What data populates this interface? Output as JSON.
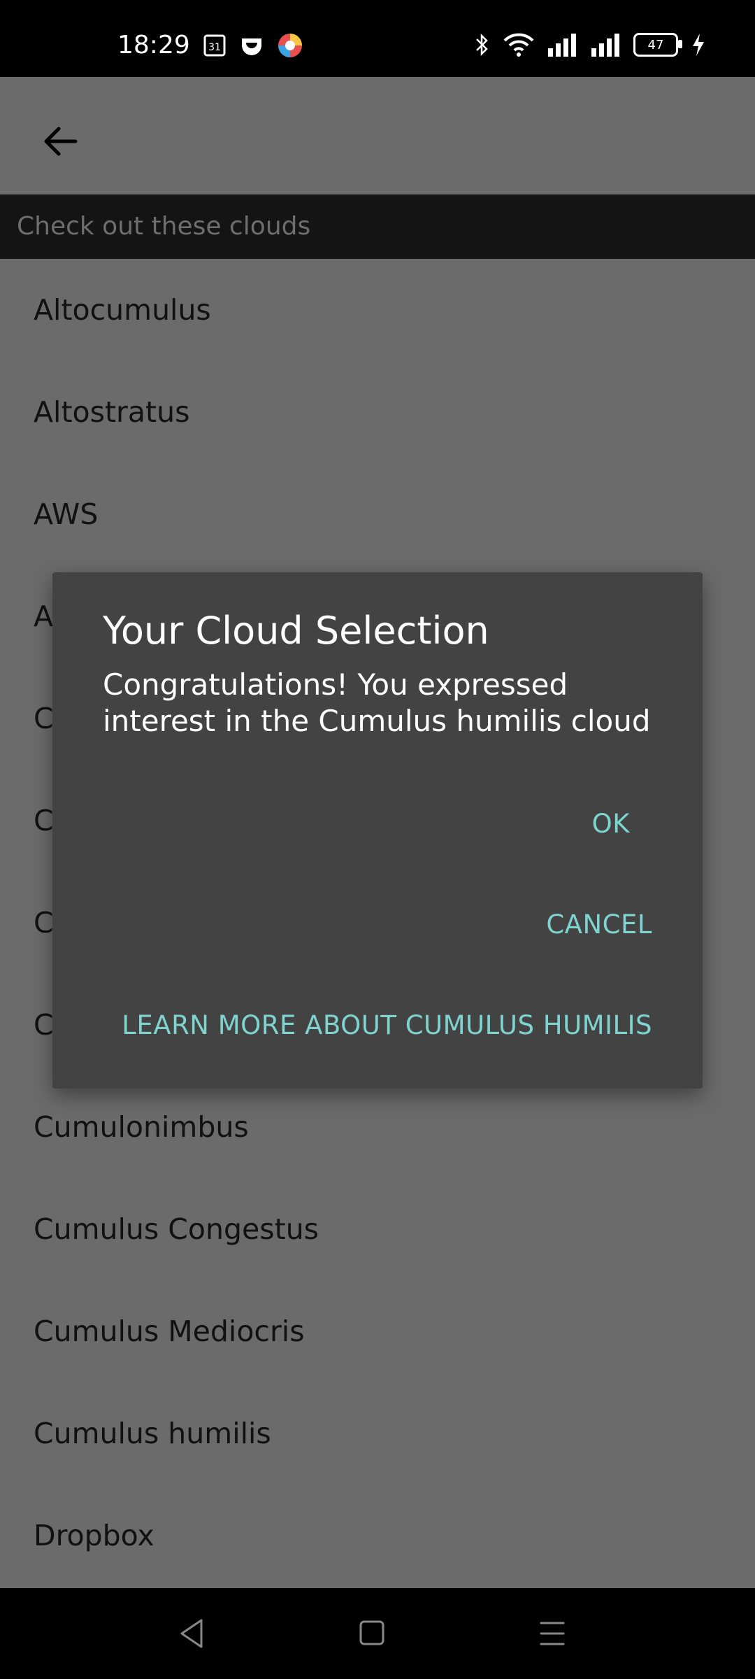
{
  "status_bar": {
    "time": "18:29",
    "calendar_day": "31",
    "battery": "47"
  },
  "header": {
    "back_icon": "arrow-left-icon"
  },
  "section_header": "Check out these clouds",
  "list_items": [
    "Altocumulus",
    "Altostratus",
    "AWS",
    "A",
    "C",
    "C",
    "C",
    "C",
    "Cumulonimbus",
    "Cumulus Congestus",
    "Cumulus Mediocris",
    "Cumulus humilis",
    "Dropbox"
  ],
  "dialog": {
    "title": "Your Cloud Selection",
    "message": "Congratulations! You expressed interest in the Cumulus humilis cloud",
    "ok": "OK",
    "cancel": "CANCEL",
    "learn_more": "LEARN MORE ABOUT CUMULUS HUMILIS"
  },
  "colors": {
    "accent": "#7fd4cf",
    "dialog_bg": "#434343",
    "scrim_bg": "#6b6b6b"
  }
}
